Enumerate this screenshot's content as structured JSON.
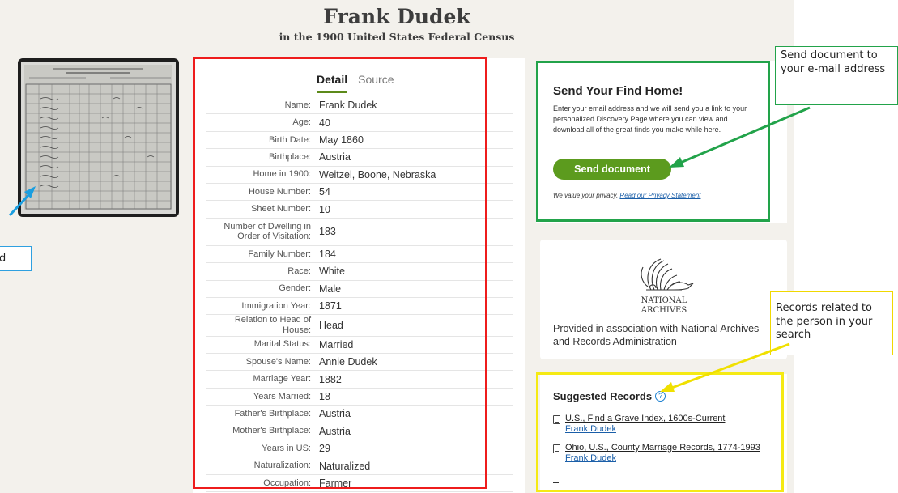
{
  "header": {
    "title": "Frank Dudek",
    "subtitle": "in the 1900 United States Federal Census"
  },
  "left_callout": {
    "text": "d"
  },
  "detail": {
    "tabs": [
      {
        "label": "Detail",
        "active": true
      },
      {
        "label": "Source",
        "active": false
      }
    ],
    "rows": [
      {
        "label": "Name:",
        "value": "Frank Dudek"
      },
      {
        "label": "Age:",
        "value": "40"
      },
      {
        "label": "Birth Date:",
        "value": "May 1860"
      },
      {
        "label": "Birthplace:",
        "value": "Austria"
      },
      {
        "label": "Home in 1900:",
        "value": "Weitzel, Boone, Nebraska"
      },
      {
        "label": "House Number:",
        "value": "54"
      },
      {
        "label": "Sheet Number:",
        "value": "10"
      },
      {
        "label": "Number of Dwelling in Order of Visitation:",
        "value": "183"
      },
      {
        "label": "Family Number:",
        "value": "184"
      },
      {
        "label": "Race:",
        "value": "White"
      },
      {
        "label": "Gender:",
        "value": "Male"
      },
      {
        "label": "Immigration Year:",
        "value": "1871"
      },
      {
        "label": "Relation to Head of House:",
        "value": "Head"
      },
      {
        "label": "Marital Status:",
        "value": "Married"
      },
      {
        "label": "Spouse's Name:",
        "value": "Annie Dudek"
      },
      {
        "label": "Marriage Year:",
        "value": "1882"
      },
      {
        "label": "Years Married:",
        "value": "18"
      },
      {
        "label": "Father's Birthplace:",
        "value": "Austria"
      },
      {
        "label": "Mother's Birthplace:",
        "value": "Austria"
      },
      {
        "label": "Years in US:",
        "value": "29"
      },
      {
        "label": "Naturalization:",
        "value": "Naturalized"
      },
      {
        "label": "Occupation:",
        "value": "Farmer"
      }
    ]
  },
  "send_home": {
    "title": "Send Your Find Home!",
    "description": "Enter your email address and we will send you a link to your personalized Discovery Page where you can view and download all of the great finds you make while here.",
    "button_label": "Send document",
    "privacy_text": "We value your privacy.",
    "privacy_link": "Read our Privacy Statement"
  },
  "archives": {
    "logo_line1": "NATIONAL",
    "logo_line2": "ARCHIVES",
    "provided_text": "Provided in association with National Archives and Records Administration"
  },
  "suggested": {
    "title": "Suggested Records",
    "help_glyph": "?",
    "records": [
      {
        "title": "U.S., Find a Grave Index, 1600s-Current",
        "name": "Frank Dudek"
      },
      {
        "title": "Ohio, U.S., County Marriage Records, 1774-1993",
        "name": "Frank Dudek"
      }
    ]
  },
  "callouts": {
    "green_text": "Send document to your e-mail address",
    "yellow_text": "Records related to the person in your search"
  },
  "colors": {
    "red_box": "#ee1c1c",
    "green_box": "#22a34a",
    "yellow_box": "#f5ea14",
    "button": "#5c9b1e",
    "tab_underline": "#5c8a1a",
    "link": "#1a5ea8"
  }
}
